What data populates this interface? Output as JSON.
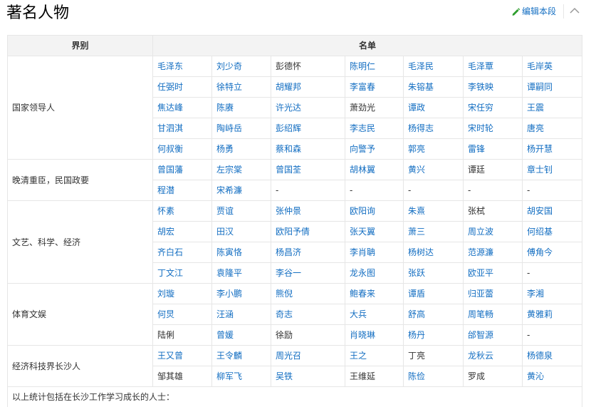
{
  "section": {
    "title": "著名人物",
    "edit_label": "编辑本段",
    "colors": {
      "link": "#136ec2",
      "text": "#333333",
      "header_bg": "#f3f3f3",
      "border": "#e6e6e6"
    }
  },
  "table": {
    "headers": [
      "界别",
      "名单"
    ],
    "groups": [
      {
        "category": "国家领导人",
        "rows": [
          [
            {
              "t": "毛泽东",
              "l": true
            },
            {
              "t": "刘少奇",
              "l": true
            },
            {
              "t": "彭德怀",
              "l": false
            },
            {
              "t": "陈明仁",
              "l": true
            },
            {
              "t": "毛泽民",
              "l": true
            },
            {
              "t": "毛泽覃",
              "l": true
            },
            {
              "t": "毛岸英",
              "l": true
            }
          ],
          [
            {
              "t": "任弼时",
              "l": true
            },
            {
              "t": "徐特立",
              "l": true
            },
            {
              "t": "胡耀邦",
              "l": true
            },
            {
              "t": "李富春",
              "l": true
            },
            {
              "t": "朱镕基",
              "l": true
            },
            {
              "t": "李铁映",
              "l": true
            },
            {
              "t": "谭嗣同",
              "l": true
            }
          ],
          [
            {
              "t": "焦达峰",
              "l": true
            },
            {
              "t": "陈赓",
              "l": true
            },
            {
              "t": "许光达",
              "l": true
            },
            {
              "t": "萧劲光",
              "l": false
            },
            {
              "t": "谭政",
              "l": true
            },
            {
              "t": "宋任穷",
              "l": true
            },
            {
              "t": "王震",
              "l": true
            }
          ],
          [
            {
              "t": "甘泗淇",
              "l": true
            },
            {
              "t": "陶峙岳",
              "l": true
            },
            {
              "t": "彭绍辉",
              "l": true
            },
            {
              "t": "李志民",
              "l": true
            },
            {
              "t": "杨得志",
              "l": true
            },
            {
              "t": "宋时轮",
              "l": true
            },
            {
              "t": "唐亮",
              "l": true
            }
          ],
          [
            {
              "t": "何叔衡",
              "l": true
            },
            {
              "t": "杨勇",
              "l": true
            },
            {
              "t": "蔡和森",
              "l": true
            },
            {
              "t": "向警予",
              "l": true
            },
            {
              "t": "郭亮",
              "l": true
            },
            {
              "t": "雷锋",
              "l": true
            },
            {
              "t": "杨开慧",
              "l": true
            }
          ]
        ]
      },
      {
        "category": "晚清重臣，民国政要",
        "rows": [
          [
            {
              "t": "曾国藩",
              "l": true
            },
            {
              "t": "左宗棠",
              "l": true
            },
            {
              "t": "曾国荃",
              "l": true
            },
            {
              "t": "胡林翼",
              "l": true
            },
            {
              "t": "黄兴",
              "l": true
            },
            {
              "t": "谭廷",
              "l": false
            },
            {
              "t": "章士钊",
              "l": true
            }
          ],
          [
            {
              "t": "程潜",
              "l": true
            },
            {
              "t": "宋希濂",
              "l": true
            },
            {
              "t": "-",
              "l": false
            },
            {
              "t": "-",
              "l": false
            },
            {
              "t": "-",
              "l": false
            },
            {
              "t": "-",
              "l": false
            },
            {
              "t": "-",
              "l": false
            }
          ]
        ]
      },
      {
        "category": "文艺、科学、经济",
        "rows": [
          [
            {
              "t": "怀素",
              "l": true
            },
            {
              "t": "贾谊",
              "l": true
            },
            {
              "t": "张仲景",
              "l": true
            },
            {
              "t": "欧阳询",
              "l": true
            },
            {
              "t": "朱熹",
              "l": true
            },
            {
              "t": "张栻",
              "l": false
            },
            {
              "t": "胡安国",
              "l": true
            }
          ],
          [
            {
              "t": "胡宏",
              "l": true
            },
            {
              "t": "田汉",
              "l": true
            },
            {
              "t": "欧阳予倩",
              "l": true
            },
            {
              "t": "张天翼",
              "l": true
            },
            {
              "t": "萧三",
              "l": true
            },
            {
              "t": "周立波",
              "l": true
            },
            {
              "t": "何绍基",
              "l": true
            }
          ],
          [
            {
              "t": "齐白石",
              "l": true
            },
            {
              "t": "陈寅恪",
              "l": true
            },
            {
              "t": "杨昌济",
              "l": true
            },
            {
              "t": "李肖聃",
              "l": true
            },
            {
              "t": "杨树达",
              "l": true
            },
            {
              "t": "范源濂",
              "l": true
            },
            {
              "t": "傅角今",
              "l": true
            }
          ],
          [
            {
              "t": "丁文江",
              "l": true
            },
            {
              "t": "袁隆平",
              "l": true
            },
            {
              "t": "李谷一",
              "l": true
            },
            {
              "t": "龙永图",
              "l": true
            },
            {
              "t": "张跃",
              "l": true
            },
            {
              "t": "欧亚平",
              "l": true
            },
            {
              "t": "-",
              "l": false
            }
          ]
        ]
      },
      {
        "category": "体育文娱",
        "rows": [
          [
            {
              "t": "刘璇",
              "l": true
            },
            {
              "t": "李小鹏",
              "l": true
            },
            {
              "t": "熊倪",
              "l": true
            },
            {
              "t": "鲍春来",
              "l": true
            },
            {
              "t": "谭盾",
              "l": true
            },
            {
              "t": "归亚蕾",
              "l": true
            },
            {
              "t": "李湘",
              "l": true
            }
          ],
          [
            {
              "t": "何炅",
              "l": true
            },
            {
              "t": "汪涵",
              "l": true
            },
            {
              "t": "奇志",
              "l": true
            },
            {
              "t": "大兵",
              "l": true
            },
            {
              "t": "舒高",
              "l": true
            },
            {
              "t": "周笔畅",
              "l": true
            },
            {
              "t": "黄雅莉",
              "l": true
            }
          ],
          [
            {
              "t": "陆俐",
              "l": false
            },
            {
              "t": "曾媛",
              "l": true
            },
            {
              "t": "徐励",
              "l": false
            },
            {
              "t": "肖晓琳",
              "l": true
            },
            {
              "t": "杨丹",
              "l": true
            },
            {
              "t": "邰智源",
              "l": true
            },
            {
              "t": "-",
              "l": false
            }
          ]
        ]
      },
      {
        "category": "经济科技界长沙人",
        "rows": [
          [
            {
              "t": "王又曾",
              "l": true
            },
            {
              "t": "王令麟",
              "l": true
            },
            {
              "t": "周光召",
              "l": true
            },
            {
              "t": "王之",
              "l": true
            },
            {
              "t": "丁亮",
              "l": false
            },
            {
              "t": "龙秋云",
              "l": true
            },
            {
              "t": "杨德泉",
              "l": true
            }
          ],
          [
            {
              "t": "邹其雄",
              "l": false
            },
            {
              "t": "柳军飞",
              "l": true
            },
            {
              "t": "吴铁",
              "l": true
            },
            {
              "t": "王维延",
              "l": false
            },
            {
              "t": "陈俭",
              "l": true
            },
            {
              "t": "罗成",
              "l": false
            },
            {
              "t": "黄沁",
              "l": true
            }
          ]
        ]
      }
    ],
    "footnote": "以上统计包括在长沙工作学习成长的人士："
  }
}
